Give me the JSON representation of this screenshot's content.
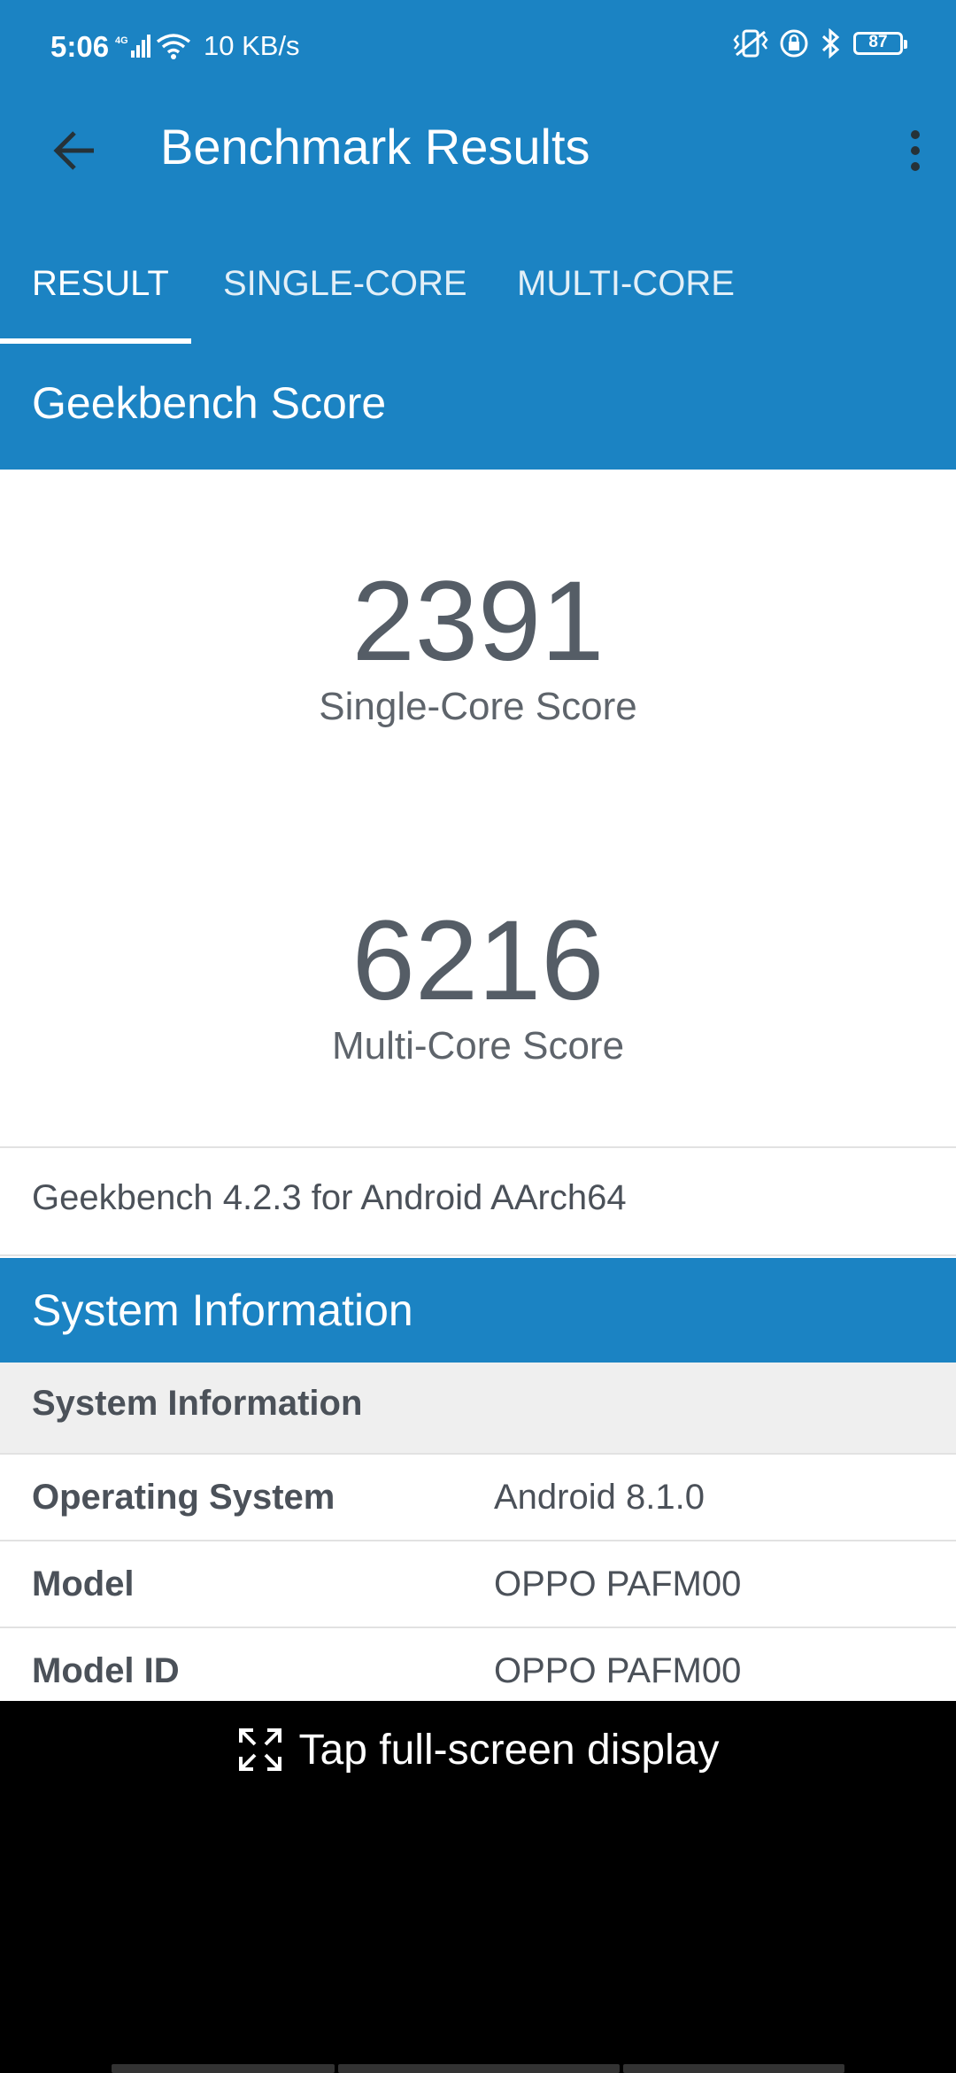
{
  "status_bar": {
    "time": "5:06",
    "network_speed": "10 KB/s",
    "battery_level": "87",
    "icons": [
      "signal-4g-icon",
      "wifi-icon",
      "vibrate-icon",
      "lock-icon",
      "bluetooth-icon",
      "battery-icon"
    ]
  },
  "toolbar": {
    "title": "Benchmark Results",
    "back_icon": "arrow-left-icon",
    "menu_icon": "more-vert-icon"
  },
  "tabs": [
    {
      "label": "RESULT",
      "selected": true
    },
    {
      "label": "SINGLE-CORE",
      "selected": false
    },
    {
      "label": "MULTI-CORE",
      "selected": false
    }
  ],
  "geekbench": {
    "header": "Geekbench Score",
    "single_core_score": "2391",
    "single_core_label": "Single-Core Score",
    "multi_core_score": "6216",
    "multi_core_label": "Multi-Core Score",
    "version": "Geekbench 4.2.3 for Android AArch64"
  },
  "system_info": {
    "header": "System Information",
    "subheader": "System Information",
    "rows": [
      {
        "key": "Operating System",
        "value": "Android 8.1.0"
      },
      {
        "key": "Model",
        "value": "OPPO PAFM00"
      },
      {
        "key": "Model ID",
        "value": "OPPO PAFM00"
      }
    ]
  },
  "overlay": {
    "hint": "Tap full-screen display",
    "hint_icon": "fullscreen-icon"
  },
  "colors": {
    "primary": "#1b83c3",
    "text_dark": "#4b5159",
    "subheader_bg": "#efefef"
  }
}
